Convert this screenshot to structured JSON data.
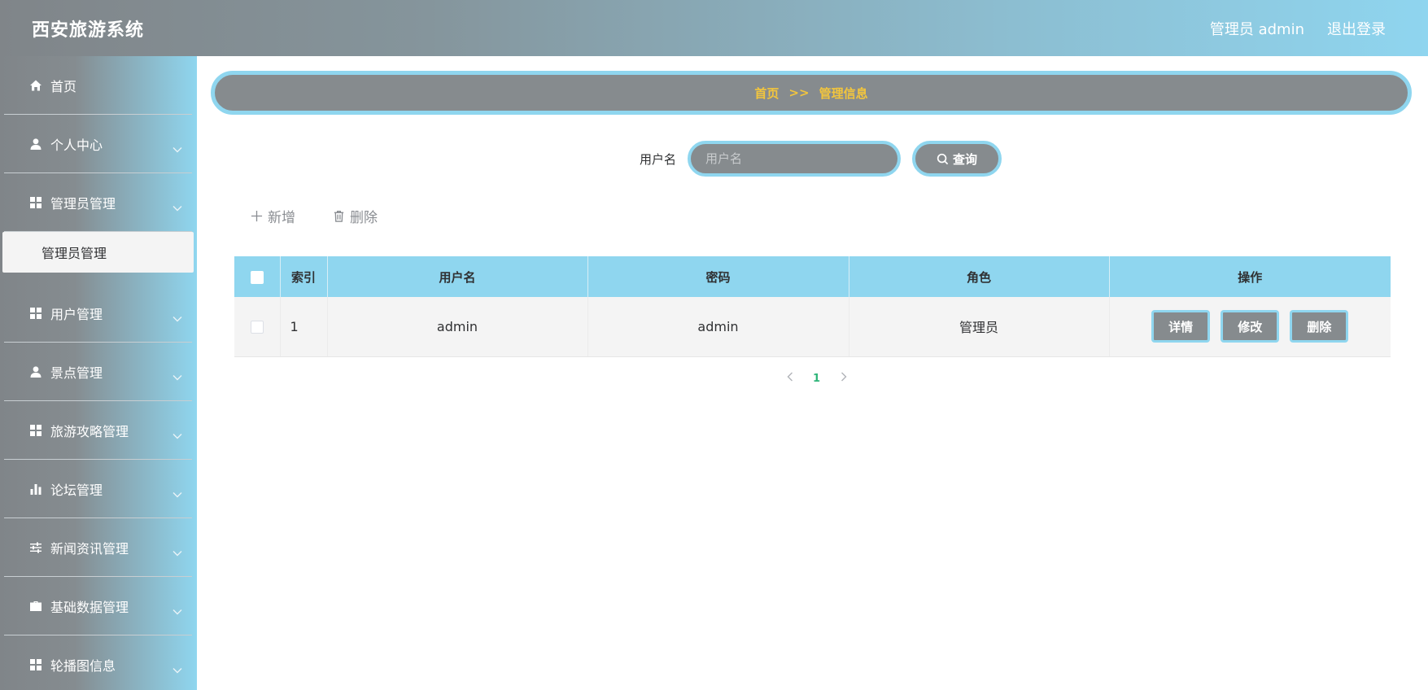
{
  "header": {
    "app_title": "西安旅游系统",
    "admin_label": "管理员 admin",
    "logout_label": "退出登录"
  },
  "sidebar": {
    "items": [
      {
        "label": "首页",
        "icon": "home-icon"
      },
      {
        "label": "个人中心",
        "icon": "user-icon"
      },
      {
        "label": "管理员管理",
        "icon": "grid-icon"
      },
      {
        "label": "用户管理",
        "icon": "grid-icon"
      },
      {
        "label": "景点管理",
        "icon": "user-icon"
      },
      {
        "label": "旅游攻略管理",
        "icon": "grid-icon"
      },
      {
        "label": "论坛管理",
        "icon": "bar-chart-icon"
      },
      {
        "label": "新闻资讯管理",
        "icon": "sliders-icon"
      },
      {
        "label": "基础数据管理",
        "icon": "briefcase-icon"
      },
      {
        "label": "轮播图信息",
        "icon": "grid-icon"
      }
    ],
    "active_submenu": "管理员管理"
  },
  "breadcrumb": {
    "home": "首页",
    "separator": ">>",
    "current": "管理信息"
  },
  "search": {
    "label": "用户名",
    "placeholder": "用户名",
    "value": "",
    "button_label": "查询"
  },
  "actions": {
    "add_label": "新增",
    "delete_label": "删除"
  },
  "table": {
    "columns": [
      "索引",
      "用户名",
      "密码",
      "角色",
      "操作"
    ],
    "rows": [
      {
        "index": "1",
        "username": "admin",
        "password": "admin",
        "role": "管理员"
      }
    ],
    "row_actions": {
      "detail": "详情",
      "edit": "修改",
      "delete": "删除"
    }
  },
  "pagination": {
    "current_page": "1"
  },
  "colors": {
    "accent": "#8fd6ef",
    "gray": "#868b8e",
    "breadcrumb_text": "#f2c53d",
    "page_active": "#2fb57a"
  }
}
